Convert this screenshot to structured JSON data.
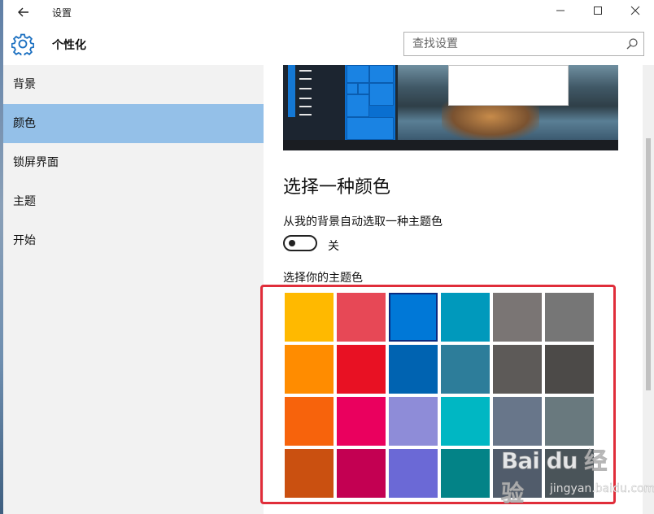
{
  "window": {
    "title": "设置",
    "back_icon": "back-arrow-icon",
    "controls": {
      "minimize": "─",
      "maximize": "☐",
      "close": "✕"
    }
  },
  "header": {
    "icon": "gear-icon",
    "title": "个性化",
    "search": {
      "placeholder": "查找设置",
      "icon": "search-icon"
    }
  },
  "sidebar": {
    "items": [
      {
        "label": "背景",
        "selected": false
      },
      {
        "label": "颜色",
        "selected": true
      },
      {
        "label": "锁屏界面",
        "selected": false
      },
      {
        "label": "主题",
        "selected": false
      },
      {
        "label": "开始",
        "selected": false
      }
    ]
  },
  "main": {
    "heading": "选择一种颜色",
    "auto_pick_label": "从我的背景自动选取一种主题色",
    "toggle": {
      "state_label": "关",
      "on": false
    },
    "pick_label": "选择你的主题色",
    "swatches": [
      [
        "#FFB900",
        "#E74856",
        "#0078D7",
        "#0099BC",
        "#7A7574",
        "#767676"
      ],
      [
        "#FF8C00",
        "#E81123",
        "#0063B1",
        "#2D7D9A",
        "#5D5A58",
        "#4C4A48"
      ],
      [
        "#F7630C",
        "#EA005E",
        "#8E8CD8",
        "#00B7C3",
        "#68768A",
        "#69797E"
      ],
      [
        "#CA5010",
        "#C30052",
        "#6B69D6",
        "#038387",
        "#515C6B",
        "#4A5459"
      ]
    ],
    "selected_swatch": {
      "row": 0,
      "col": 2
    }
  },
  "colors": {
    "sidebar_bg": "#F2F2F2",
    "selected_nav": "#94C0E8",
    "highlight": "#E02D3A"
  },
  "watermark": {
    "logo": "Bai du 经验",
    "url": "jingyan.baidu.com"
  }
}
